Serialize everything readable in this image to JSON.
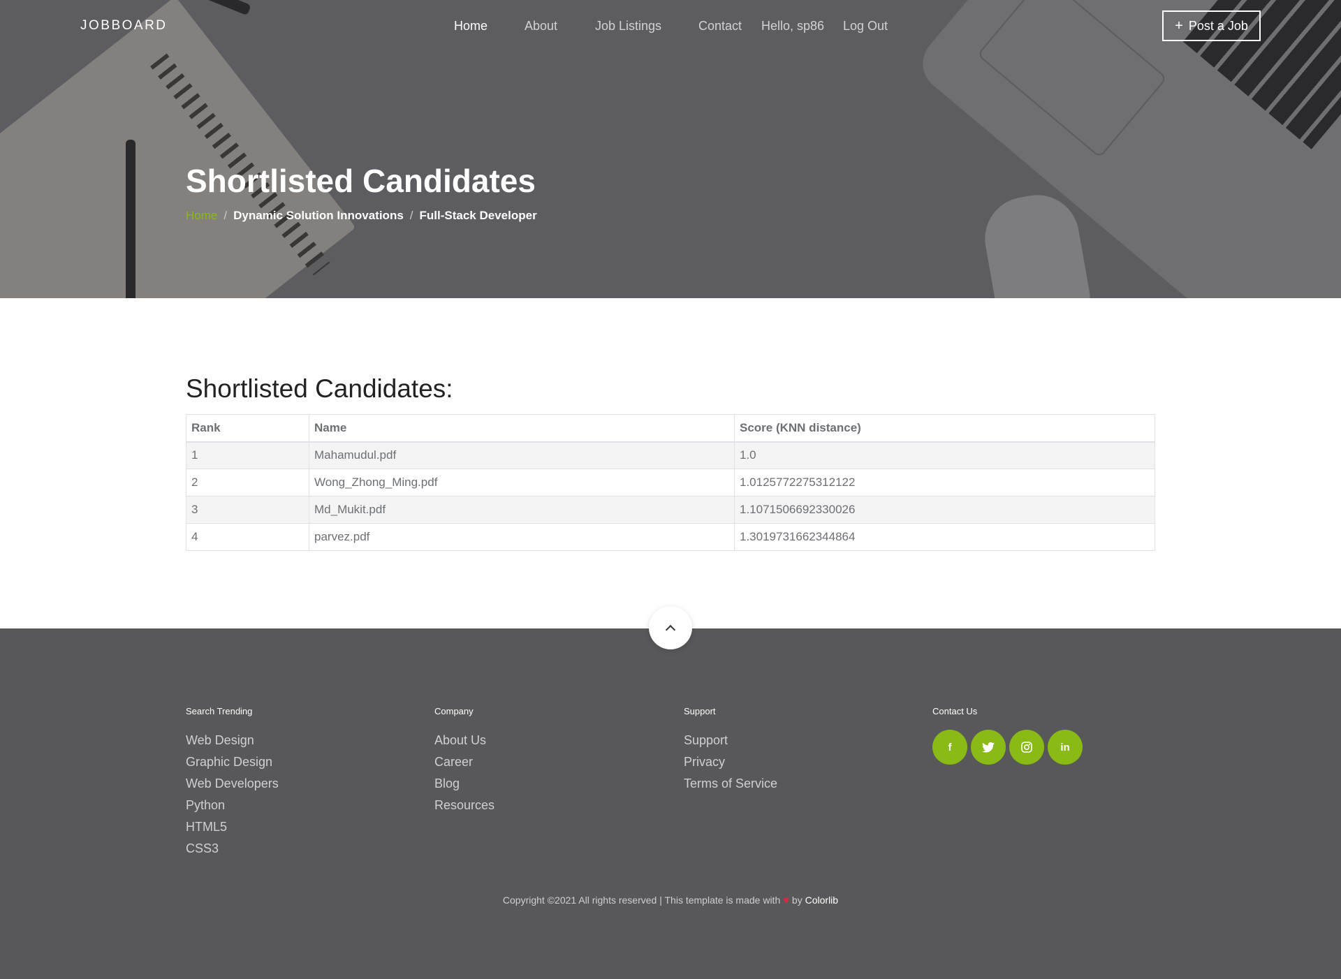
{
  "nav": {
    "brand": "JOBBOARD",
    "items": [
      "Home",
      "About",
      "Job Listings",
      "Contact"
    ],
    "greeting": "Hello, sp86",
    "logout": "Log Out",
    "post_job": "Post a Job"
  },
  "hero": {
    "title": "Shortlisted Candidates",
    "breadcrumb": {
      "home": "Home",
      "sep": "/",
      "company": "Dynamic Solution Innovations",
      "job": "Full-Stack Developer"
    }
  },
  "main": {
    "title": "Shortlisted Candidates:",
    "columns": [
      "Rank",
      "Name",
      "Score (KNN distance)"
    ],
    "rows": [
      [
        "1",
        "Mahamudul.pdf",
        "1.0"
      ],
      [
        "2",
        "Wong_Zhong_Ming.pdf",
        "1.0125772275312122"
      ],
      [
        "3",
        "Md_Mukit.pdf",
        "1.1071506692330026"
      ],
      [
        "4",
        "parvez.pdf",
        "1.3019731662344864"
      ]
    ]
  },
  "footer": {
    "columns": [
      {
        "title": "Search Trending",
        "items": [
          "Web Design",
          "Graphic Design",
          "Web Developers",
          "Python",
          "HTML5",
          "CSS3"
        ]
      },
      {
        "title": "Company",
        "items": [
          "About Us",
          "Career",
          "Blog",
          "Resources"
        ]
      },
      {
        "title": "Support",
        "items": [
          "Support",
          "Privacy",
          "Terms of Service"
        ]
      }
    ],
    "contact": {
      "title": "Contact Us",
      "social": [
        {
          "icon": "facebook-icon",
          "glyph": "f"
        },
        {
          "icon": "twitter-icon",
          "glyph": "t"
        },
        {
          "icon": "instagram-icon",
          "glyph": "◎"
        },
        {
          "icon": "linkedin-icon",
          "glyph": "in"
        }
      ]
    },
    "copyright_pre": "Copyright ©2021 All rights reserved | This template is made with",
    "copyright_by": "by",
    "copyright_link": "Colorlib"
  },
  "colors": {
    "accent": "#89ba16",
    "footer_bg": "#58585a",
    "heart": "#e0263b"
  }
}
